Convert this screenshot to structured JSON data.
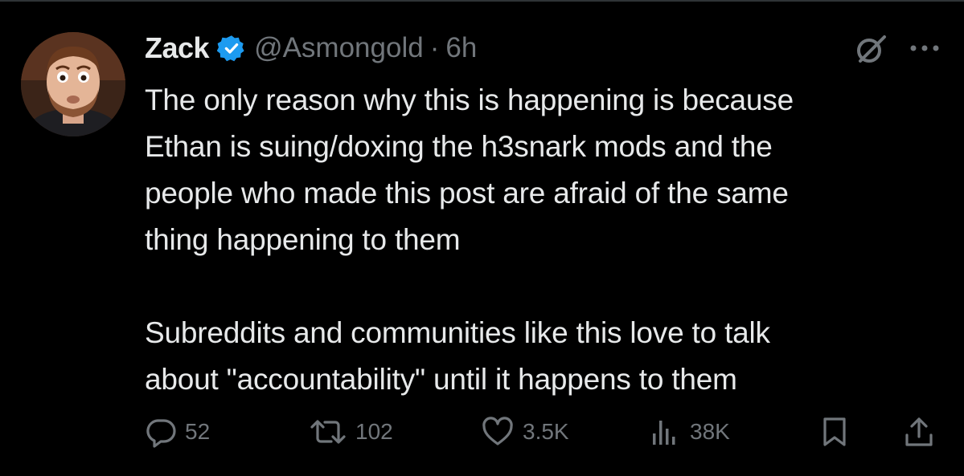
{
  "tweet": {
    "author_name": "Zack",
    "handle": "@Asmongold",
    "separator": "·",
    "time": "6h",
    "body_lines_p1": [
      "The only reason why this is happening is because",
      "Ethan is suing/doxing the h3snark mods and the",
      "people who made this post are afraid of the same",
      "thing happening to them"
    ],
    "body_lines_p2": [
      "Subreddits and communities like this love to talk",
      "about \"accountability\" until it happens to them"
    ]
  },
  "metrics": {
    "replies": "52",
    "reposts": "102",
    "likes": "3.5K",
    "views": "38K"
  },
  "icons": {
    "verified": "verified-badge-icon",
    "grok": "grok-icon",
    "more": "more-options-icon",
    "reply": "reply-icon",
    "repost": "repost-icon",
    "like": "like-icon",
    "views": "views-icon",
    "bookmark": "bookmark-icon",
    "share": "share-icon"
  },
  "colors": {
    "background": "#000000",
    "text": "#e7e9ea",
    "secondary": "#71767b",
    "verified_blue": "#1d9bf0"
  }
}
